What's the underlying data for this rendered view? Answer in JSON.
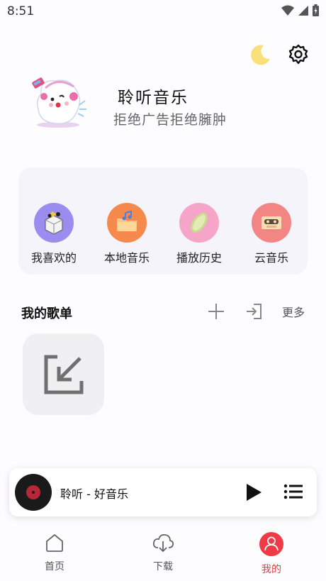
{
  "status_bar": {
    "time": "8:51"
  },
  "header": {
    "title": "聆听音乐",
    "subtitle": "拒绝广告拒绝臃肿",
    "icons": [
      "moon-icon",
      "gear-icon"
    ]
  },
  "quick_access": [
    {
      "label": "我喜欢的",
      "icon": "favorite-icon",
      "color": "#9b8cf0"
    },
    {
      "label": "本地音乐",
      "icon": "folder-icon",
      "color": "#f58a4c"
    },
    {
      "label": "播放历史",
      "icon": "history-icon",
      "color": "#f6a5c8"
    },
    {
      "label": "云音乐",
      "icon": "cassette-icon",
      "color": "#f38585"
    }
  ],
  "playlists": {
    "title": "我的歌单",
    "more_label": "更多"
  },
  "player": {
    "track": "聆听 - 好音乐"
  },
  "bottom_nav": [
    {
      "label": "首页",
      "icon": "home-icon",
      "active": false
    },
    {
      "label": "下载",
      "icon": "cloud-download-icon",
      "active": false
    },
    {
      "label": "我的",
      "icon": "user-icon",
      "active": true
    }
  ],
  "colors": {
    "accent": "#ef3b45",
    "card_bg": "#f4f4fa"
  }
}
